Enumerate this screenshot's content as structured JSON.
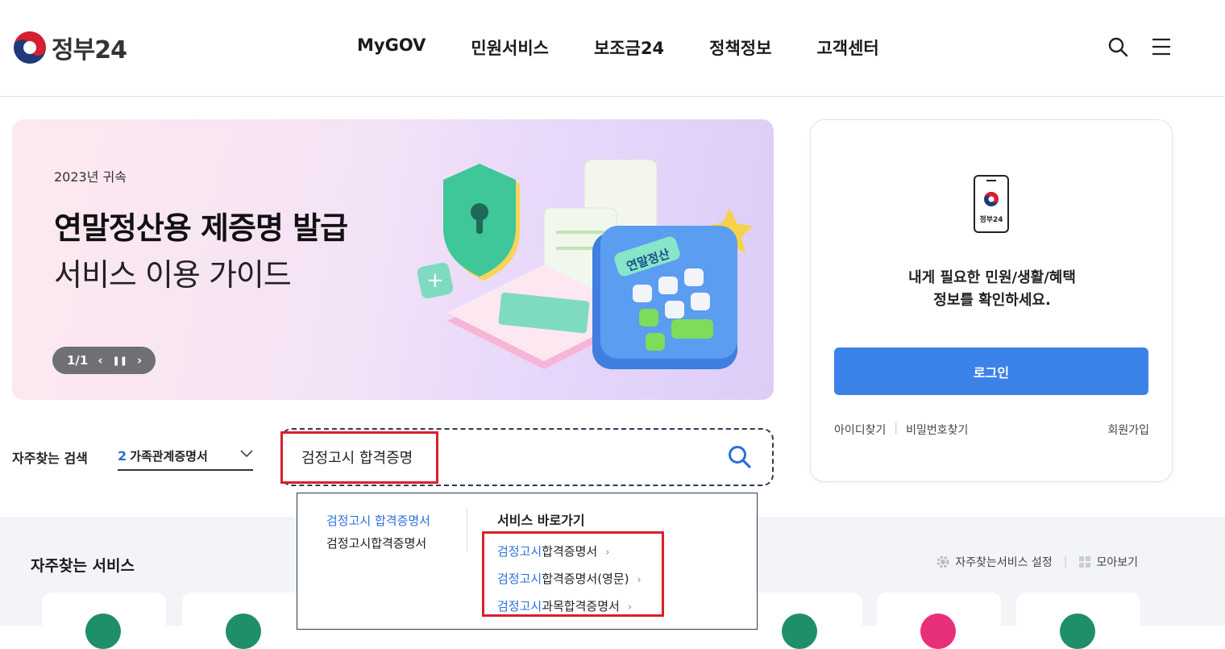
{
  "header": {
    "logo_text": "정부24",
    "nav": [
      "MyGOV",
      "민원서비스",
      "보조금24",
      "정책정보",
      "고객센터"
    ],
    "icons": [
      "search-icon",
      "menu-icon"
    ]
  },
  "banner": {
    "eyebrow": "2023년 귀속",
    "title": "연말정산용 제증명 발급",
    "subtitle": "서비스 이용 가이드",
    "pager": "1/1",
    "calc_label": "연말정산"
  },
  "login": {
    "brand": "정부24",
    "message_line1": "내게 필요한 민원/생활/혜택",
    "message_line2": "정보를 확인하세요.",
    "button": "로그인",
    "find_id": "아이디찾기",
    "find_pw": "비밀번호찾기",
    "join": "회원가입"
  },
  "search": {
    "freq_label": "자주찾는 검색",
    "freq_rank": "2",
    "freq_term": "가족관계증명서",
    "query": "검정고시 합격증명"
  },
  "autocomplete": {
    "suggestions": [
      "검정고시 합격증명서",
      "검정고시합격증명서"
    ],
    "shortcut_heading": "서비스 바로가기",
    "shortcuts": [
      {
        "hl": "검정고시",
        "rest": "합격증명서"
      },
      {
        "hl": "검정고시",
        "rest": "합격증명서(영문)"
      },
      {
        "hl": "검정고시",
        "rest": "과목합격증명서"
      }
    ]
  },
  "frequent_services": {
    "title": "자주찾는 서비스",
    "settings": "자주찾는서비스 설정",
    "view_all": "모아보기"
  },
  "colors": {
    "accent": "#3b82e8",
    "highlight_text": "#2a6fdb",
    "annotation_red": "#d9202b",
    "service_green": "#1f8f6a",
    "service_pink": "#e8307a"
  }
}
